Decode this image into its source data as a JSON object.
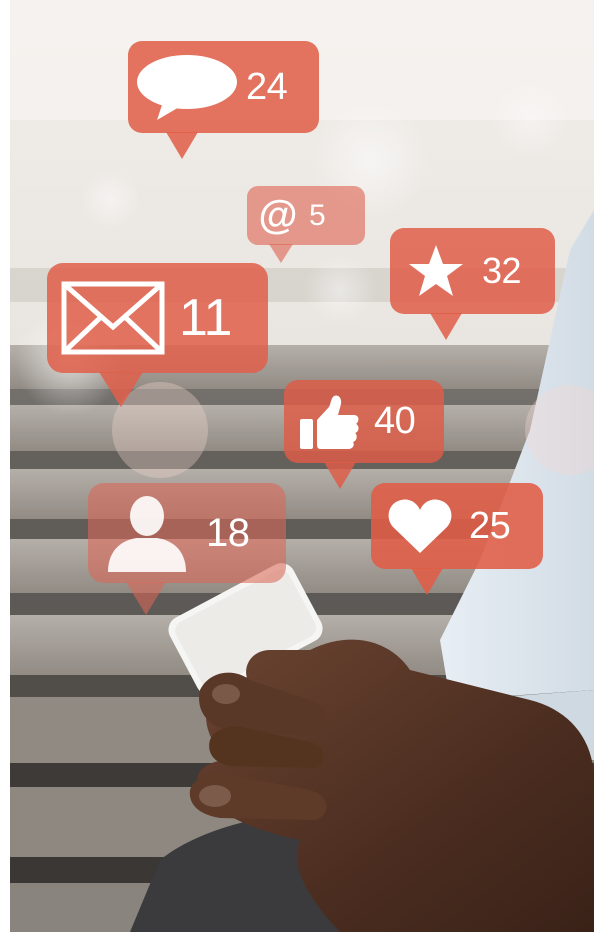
{
  "image": {
    "description": "Hands holding a smartphone with floating social media notification bubbles",
    "accent_color": "#e05c46"
  },
  "notifications": [
    {
      "id": "comments",
      "icon": "speech-bubble-icon",
      "count": "24"
    },
    {
      "id": "mentions",
      "icon": "at-sign-icon",
      "symbol": "@",
      "count": "5"
    },
    {
      "id": "favorites",
      "icon": "star-icon",
      "count": "32"
    },
    {
      "id": "messages",
      "icon": "envelope-icon",
      "count": "11"
    },
    {
      "id": "likes",
      "icon": "thumbs-up-icon",
      "count": "40"
    },
    {
      "id": "followers",
      "icon": "person-icon",
      "count": "18"
    },
    {
      "id": "hearts",
      "icon": "heart-icon",
      "count": "25"
    }
  ]
}
